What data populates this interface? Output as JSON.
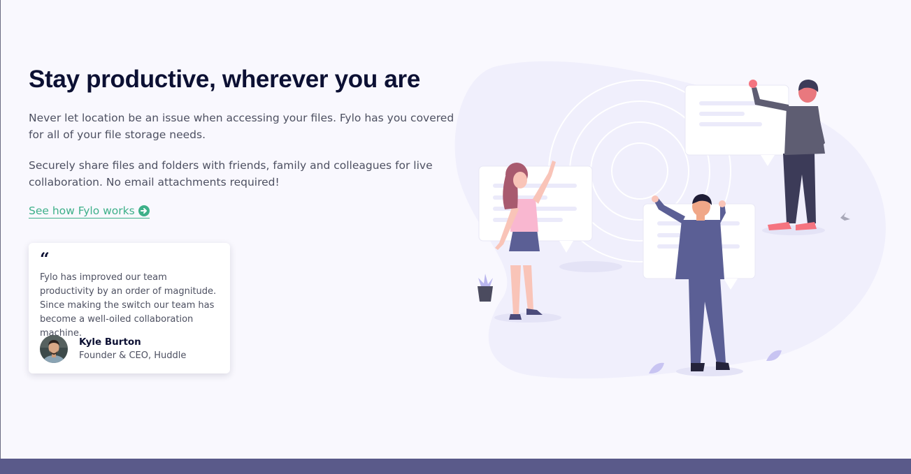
{
  "hero": {
    "heading": "Stay productive, wherever you are",
    "paragraph_1": "Never let location be an issue when accessing your files. Fylo has you covered for all of your file storage needs.",
    "paragraph_2": "Securely share files and folders with friends, family and colleagues for live collaboration. No email attachments required!",
    "cta_label": "See how Fylo works",
    "cta_icon": "arrow-circle-right-icon"
  },
  "testimonial": {
    "quote_mark": "“",
    "quote": "Fylo has improved our team productivity by an order of magnitude. Since making the switch our team has become a well-oiled collaboration machine.",
    "author_name": "Kyle Burton",
    "author_role": "Founder & CEO, Huddle"
  },
  "colors": {
    "background": "#f9f8fe",
    "heading": "#0c1033",
    "body_text": "#4d5061",
    "accent_link": "#3eb089",
    "footer": "#5a5a8a"
  }
}
